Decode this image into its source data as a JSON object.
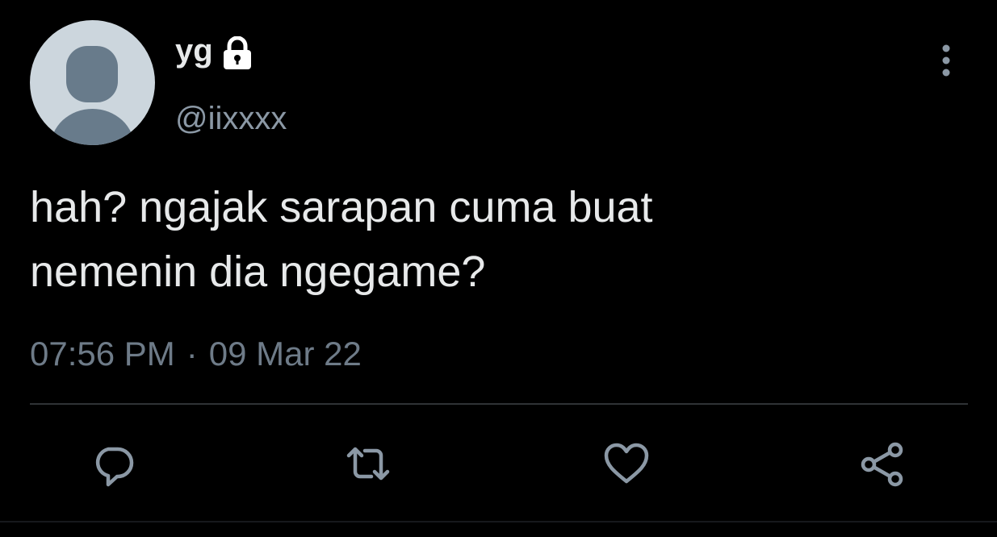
{
  "colors": {
    "background": "#000000",
    "text_primary": "#e7e9ea",
    "text_secondary": "#8b98a5",
    "meta_text": "#6e7b88",
    "icon": "#8b98a5",
    "avatar_bg": "#ccd6dd",
    "avatar_fg": "#687b8b",
    "divider": "#2f3336"
  },
  "user": {
    "display_name": "yg",
    "handle": "@iixxxx",
    "avatar_icon": "default-avatar-icon",
    "protected_icon": "lock-icon"
  },
  "tweet": {
    "text_line1": "hah? ngajak sarapan cuma buat",
    "text_line2": "nemenin dia ngegame?",
    "time": "07:56 PM",
    "separator": "·",
    "date": "09 Mar 22"
  },
  "actions": {
    "more_icon": "more-vertical-icon",
    "reply_icon": "reply-icon",
    "retweet_icon": "retweet-icon",
    "like_icon": "heart-icon",
    "share_icon": "share-icon"
  }
}
